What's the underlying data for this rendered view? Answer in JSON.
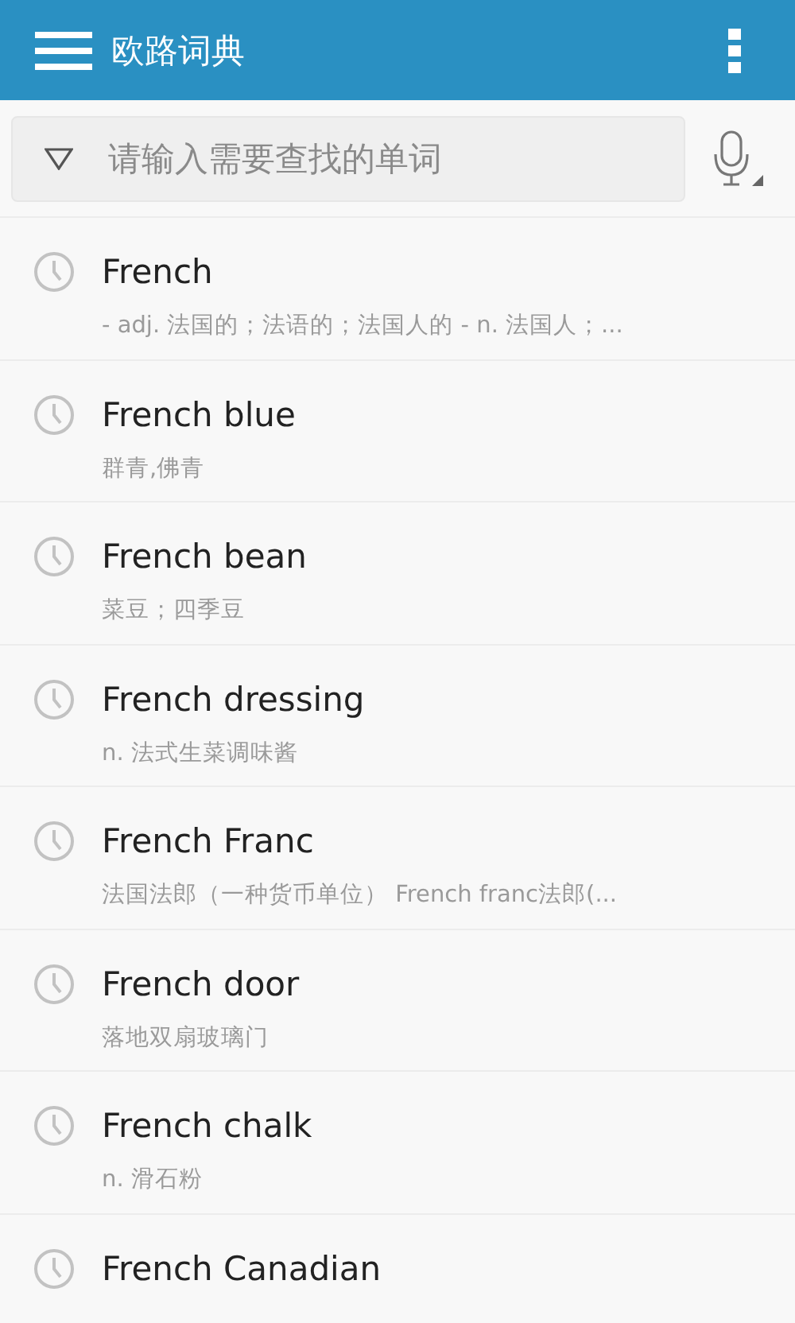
{
  "app_bar": {
    "title": "欧路词典"
  },
  "search": {
    "placeholder": "请输入需要查找的单词"
  },
  "history": [
    {
      "word": "French",
      "definition": "- adj. 法国的；法语的；法国人的 - n. 法国人；..."
    },
    {
      "word": "French blue",
      "definition": "群青,佛青"
    },
    {
      "word": "French bean",
      "definition": "菜豆；四季豆"
    },
    {
      "word": "French dressing",
      "definition": "n. 法式生菜调味酱"
    },
    {
      "word": "French Franc",
      "definition": "法国法郎（一种货币单位） French franc法郎(..."
    },
    {
      "word": "French door",
      "definition": "落地双扇玻璃门"
    },
    {
      "word": "French chalk",
      "definition": "n. 滑石粉"
    },
    {
      "word": "French Canadian"
    }
  ]
}
